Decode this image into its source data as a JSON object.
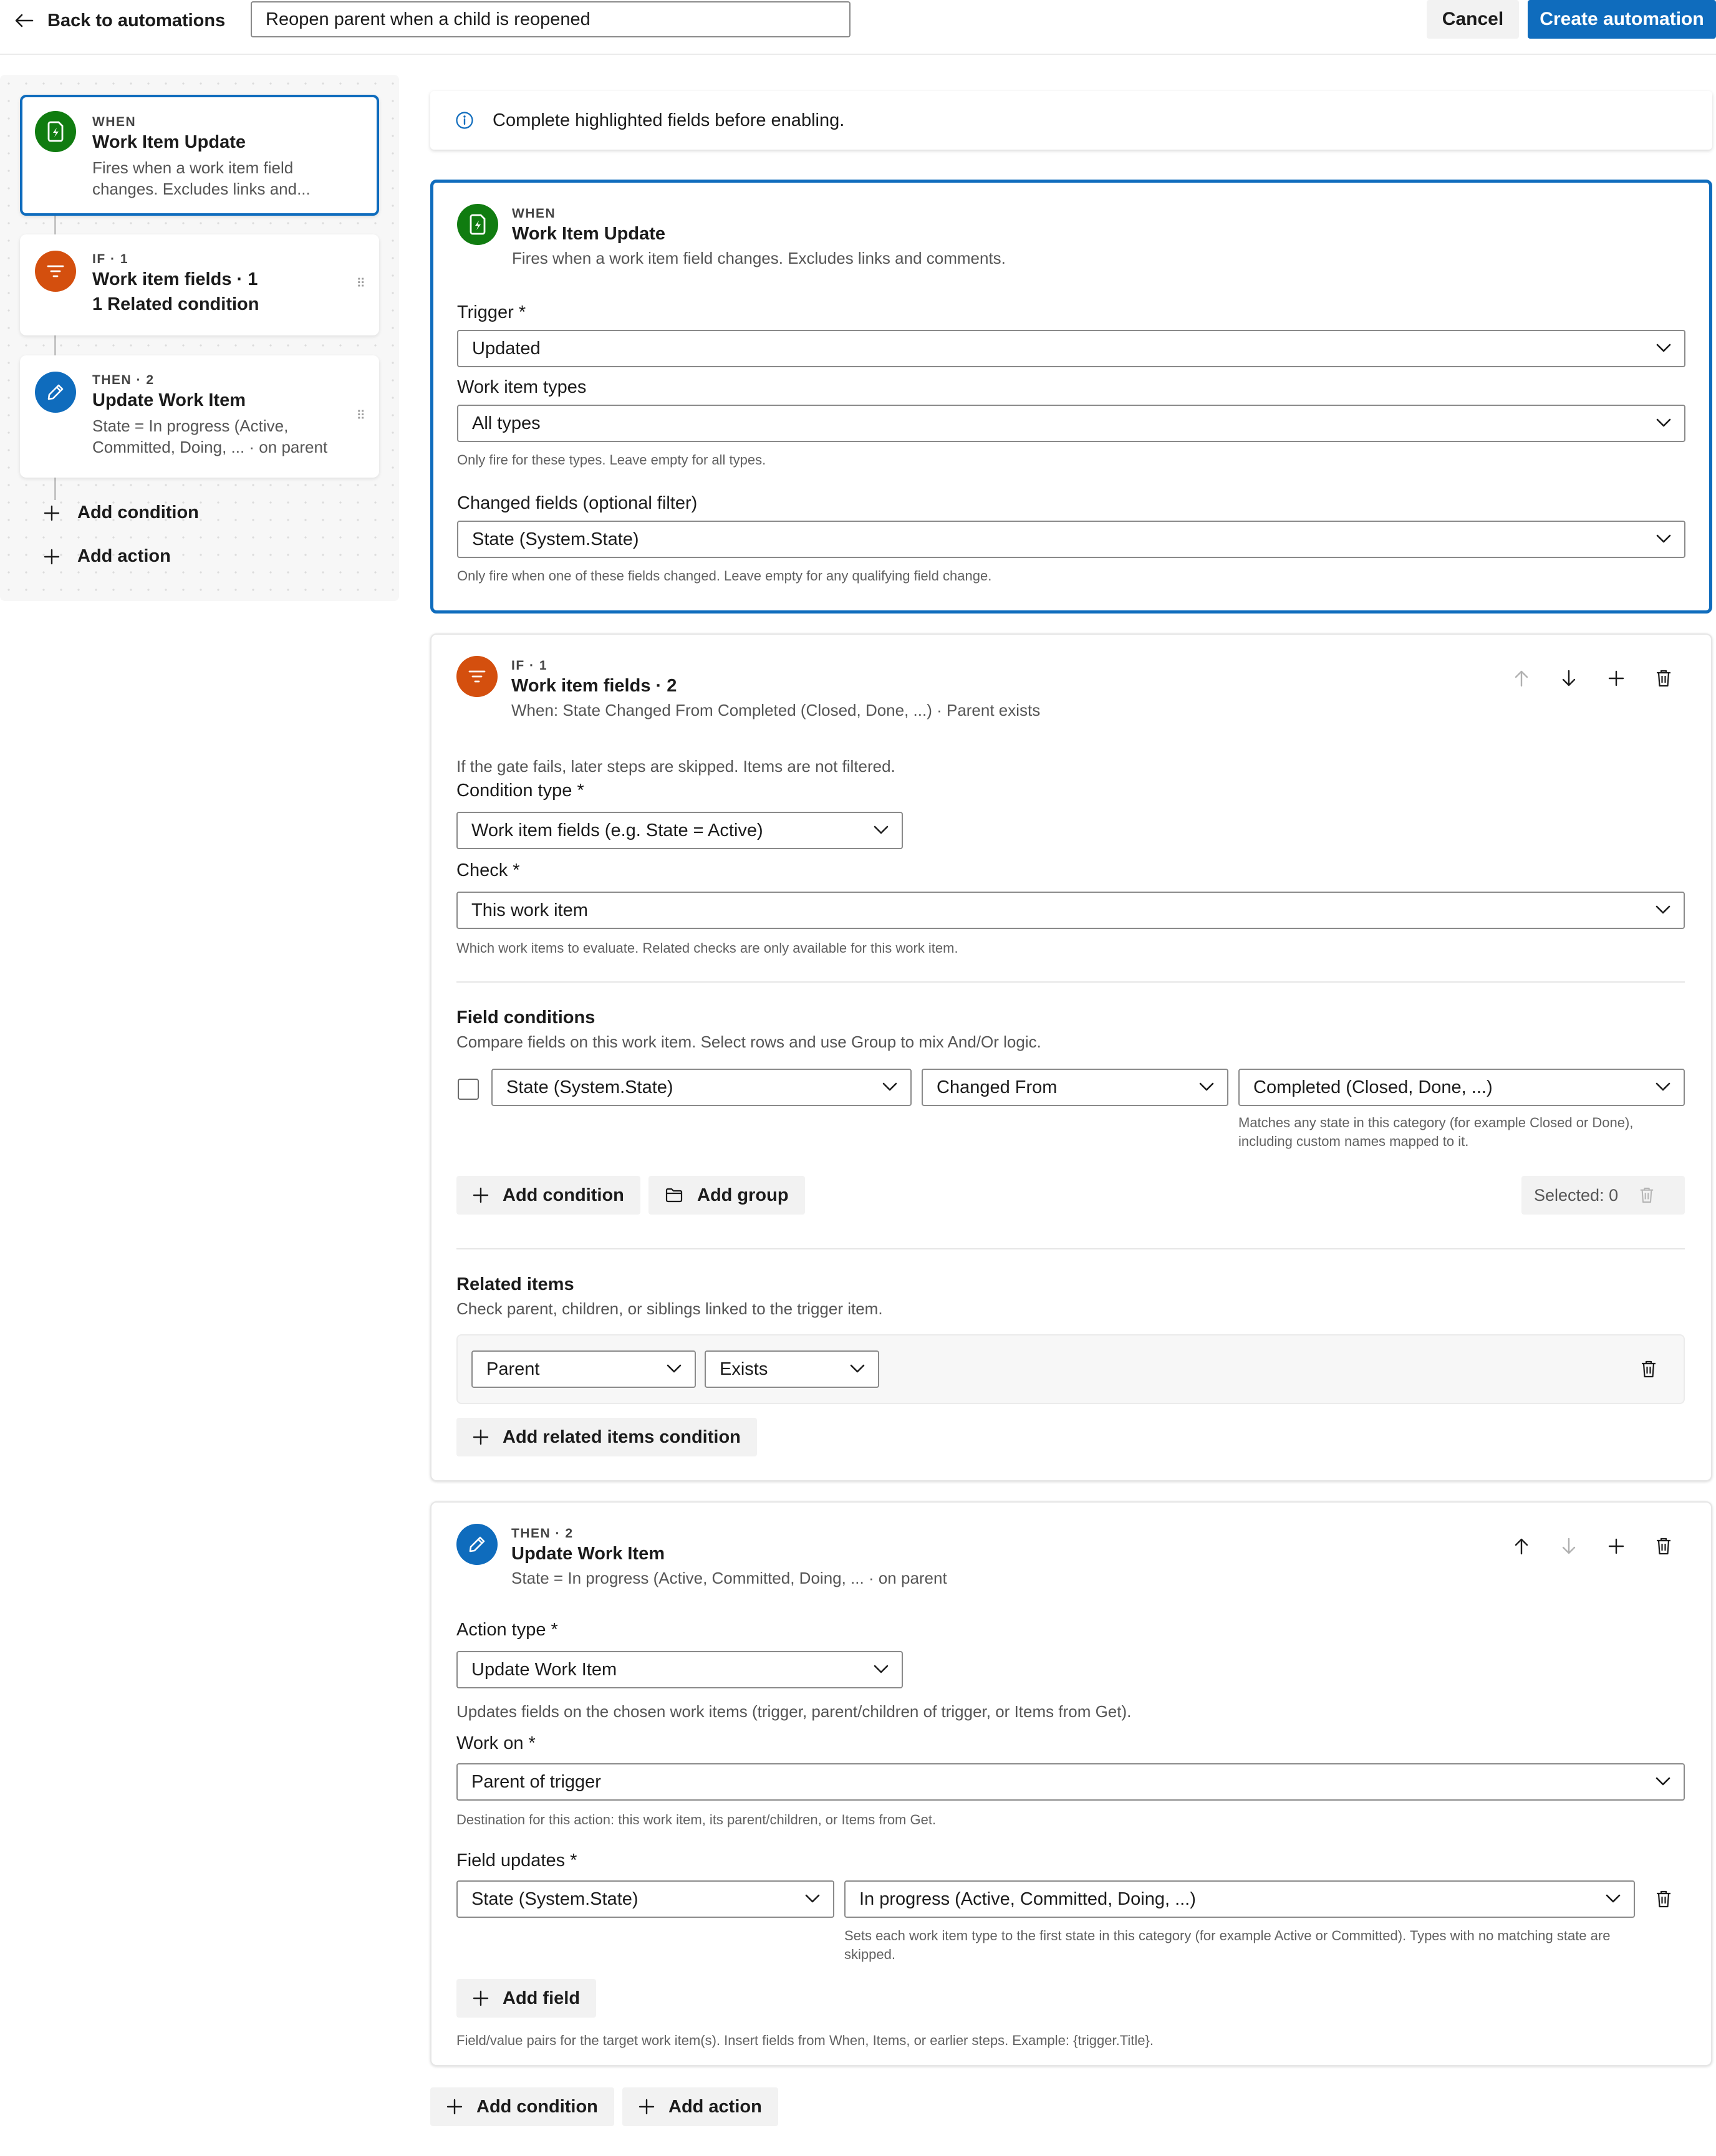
{
  "topbar": {
    "back_label": "Back to automations",
    "automation_name": "Reopen parent when a child is reopened",
    "cancel_label": "Cancel",
    "create_label": "Create automation"
  },
  "sidebar": {
    "steps": [
      {
        "kicker": "WHEN",
        "title": "Work Item Update",
        "sub": "Fires when a work item field changes. Excludes links and...",
        "icon": "lightning-doc-icon",
        "color": "#107c10"
      },
      {
        "kicker": "IF · 1",
        "title": "Work item fields · 1",
        "sub": "1 Related condition",
        "icon": "filter-icon",
        "color": "#d44f0e"
      },
      {
        "kicker": "THEN · 2",
        "title": "Update Work Item",
        "sub": "State = In progress (Active, Committed, Doing, ... · on parent",
        "icon": "pencil-icon",
        "color": "#0f6cbd"
      }
    ],
    "add_condition_label": "Add condition",
    "add_action_label": "Add action"
  },
  "notice": {
    "text": "Complete highlighted fields before enabling.",
    "icon": "info-icon"
  },
  "when_card": {
    "kicker": "WHEN",
    "title": "Work Item Update",
    "subtitle": "Fires when a work item field changes. Excludes links and comments.",
    "trigger_label": "Trigger *",
    "trigger_value": "Updated",
    "types_label": "Work item types",
    "types_value": "All types",
    "types_help": "Only fire for these types. Leave empty for all types.",
    "changed_label": "Changed fields (optional filter)",
    "changed_value": "State (System.State)",
    "changed_help": "Only fire when one of these fields changed. Leave empty for any qualifying field change."
  },
  "if_card": {
    "kicker": "IF · 1",
    "title": "Work item fields · 2",
    "subtitle": "When: State Changed From Completed (Closed, Done, ...) · Parent exists",
    "gate_note": "If the gate fails, later steps are skipped. Items are not filtered.",
    "condition_type_label": "Condition type *",
    "condition_type_value": "Work item fields (e.g. State = Active)",
    "check_label": "Check *",
    "check_value": "This work item",
    "check_help": "Which work items to evaluate. Related checks are only available for this work item.",
    "field_conditions_title": "Field conditions",
    "field_conditions_desc": "Compare fields on this work item. Select rows and use Group to mix And/Or logic.",
    "condition_row": {
      "field": "State (System.State)",
      "operator": "Changed From",
      "value": "Completed (Closed, Done, ...)",
      "value_help": "Matches any state in this category (for example Closed or Done), including custom names mapped to it."
    },
    "add_condition_label": "Add condition",
    "add_group_label": "Add group",
    "selected_label": "Selected: 0",
    "related_title": "Related items",
    "related_desc": "Check parent, children, or siblings linked to the trigger item.",
    "related_row": {
      "relation": "Parent",
      "check": "Exists"
    },
    "add_related_label": "Add related items condition"
  },
  "then_card": {
    "kicker": "THEN · 2",
    "title": "Update Work Item",
    "subtitle": "State = In progress (Active, Committed, Doing, ... · on parent",
    "action_type_label": "Action type *",
    "action_type_value": "Update Work Item",
    "action_desc": "Updates fields on the chosen work items (trigger, parent/children of trigger, or Items from Get).",
    "work_on_label": "Work on *",
    "work_on_value": "Parent of trigger",
    "work_on_help": "Destination for this action: this work item, its parent/children, or Items from Get.",
    "field_updates_label": "Field updates *",
    "field_update": {
      "field": "State (System.State)",
      "value": "In progress (Active, Committed, Doing, ...)",
      "value_help": "Sets each work item type to the first state in this category (for example Active or Committed). Types with no matching state are skipped."
    },
    "add_field_label": "Add field",
    "field_help": "Field/value pairs for the target work item(s). Insert fields from When, Items, or earlier steps. Example: {trigger.Title}."
  },
  "bottom": {
    "add_condition_label": "Add condition",
    "add_action_label": "Add action"
  }
}
